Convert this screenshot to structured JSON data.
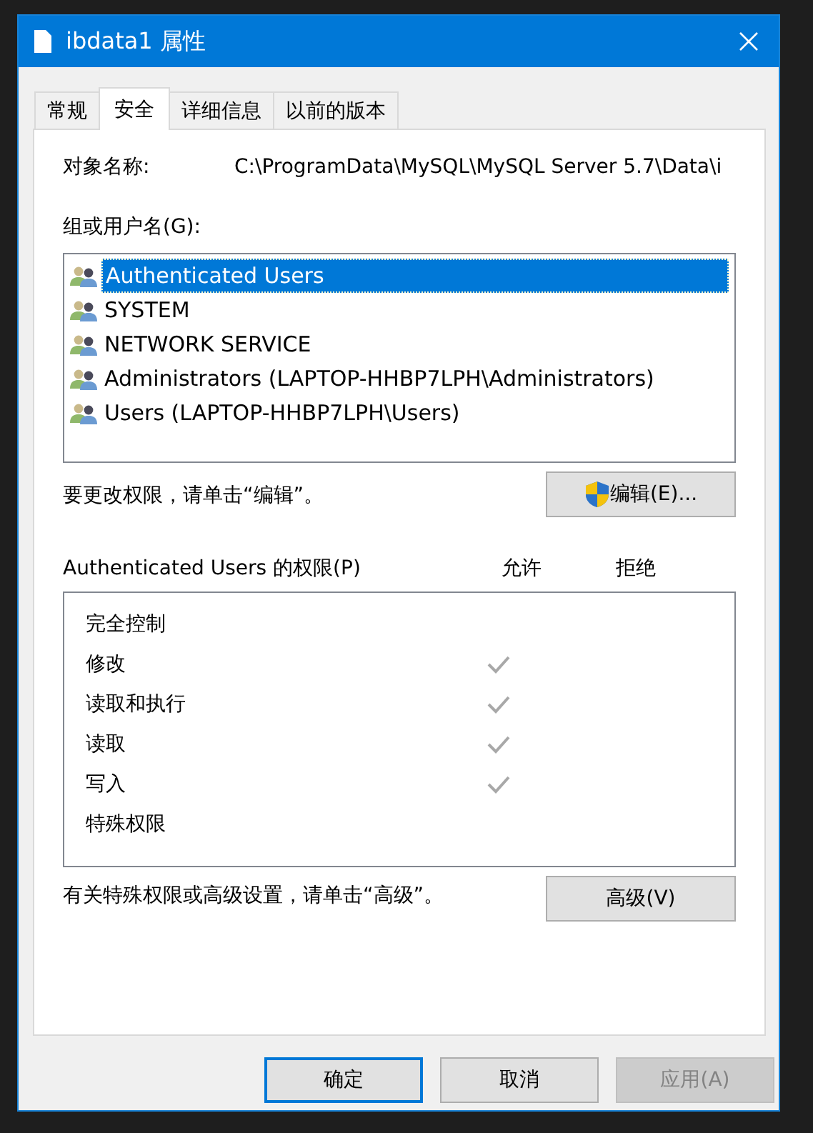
{
  "window": {
    "title": "ibdata1 属性"
  },
  "tabs": [
    {
      "label": "常规",
      "selected": false
    },
    {
      "label": "安全",
      "selected": true
    },
    {
      "label": "详细信息",
      "selected": false
    },
    {
      "label": "以前的版本",
      "selected": false
    }
  ],
  "object_name": {
    "label": "对象名称:",
    "value": "C:\\ProgramData\\MySQL\\MySQL Server 5.7\\Data\\i"
  },
  "groups": {
    "label": "组或用户名(G):",
    "items": [
      {
        "name": "Authenticated Users",
        "selected": true
      },
      {
        "name": "SYSTEM",
        "selected": false
      },
      {
        "name": "NETWORK SERVICE",
        "selected": false
      },
      {
        "name": "Administrators (LAPTOP-HHBP7LPH\\Administrators)",
        "selected": false
      },
      {
        "name": "Users (LAPTOP-HHBP7LPH\\Users)",
        "selected": false
      }
    ]
  },
  "edit_hint": "要更改权限，请单击“编辑”。",
  "edit_button": "编辑(E)...",
  "permissions": {
    "label": "Authenticated Users 的权限(P)",
    "allow_header": "允许",
    "deny_header": "拒绝",
    "rows": [
      {
        "name": "完全控制",
        "allow": false,
        "deny": false
      },
      {
        "name": "修改",
        "allow": true,
        "deny": false
      },
      {
        "name": "读取和执行",
        "allow": true,
        "deny": false
      },
      {
        "name": "读取",
        "allow": true,
        "deny": false
      },
      {
        "name": "写入",
        "allow": true,
        "deny": false
      },
      {
        "name": "特殊权限",
        "allow": false,
        "deny": false
      }
    ]
  },
  "advanced_hint": "有关特殊权限或高级设置，请单击“高级”。",
  "advanced_button": "高级(V)",
  "buttons": [
    {
      "label": "确定",
      "kind": "default",
      "disabled": false
    },
    {
      "label": "取消",
      "kind": "normal",
      "disabled": false
    },
    {
      "label": "应用(A)",
      "kind": "normal",
      "disabled": true
    }
  ]
}
